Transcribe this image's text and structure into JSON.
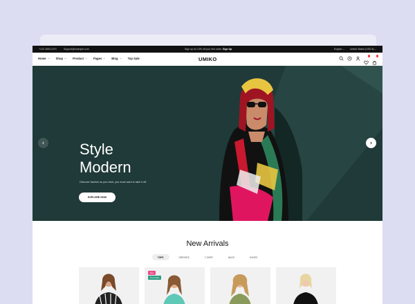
{
  "topbar": {
    "phone": "+123 1800-2470",
    "email": "Support@example.com",
    "promo_text": "Sign up for 10% off your first order.",
    "promo_link": "Sign Up",
    "language": "English ⌄",
    "country": "United States (USD $) ⌄"
  },
  "nav": {
    "logo": "UMIKO",
    "items": [
      {
        "label": "Home"
      },
      {
        "label": "Shop"
      },
      {
        "label": "Product"
      },
      {
        "label": "Pages"
      },
      {
        "label": "Blog"
      },
      {
        "label": "Top Sale"
      }
    ]
  },
  "hero": {
    "title_line1": "Style",
    "title_line2": "Modern",
    "subtitle": "Discover fashion as you wish, you must want to take it off.",
    "cta": "EXPLORE NOW"
  },
  "arrivals": {
    "title": "New Arrivals",
    "filters": [
      "TOPS",
      "DRESSES",
      "T-SHIRT",
      "BAGS",
      "SHOES"
    ],
    "tags": {
      "hot": "Hot",
      "preorder": "Pre-Order"
    }
  },
  "colors": {
    "hero_bg": "#1f3a38",
    "page_bg": "#dcdcf3",
    "accent_pink": "#e94c8b",
    "accent_teal": "#2e9e84"
  }
}
